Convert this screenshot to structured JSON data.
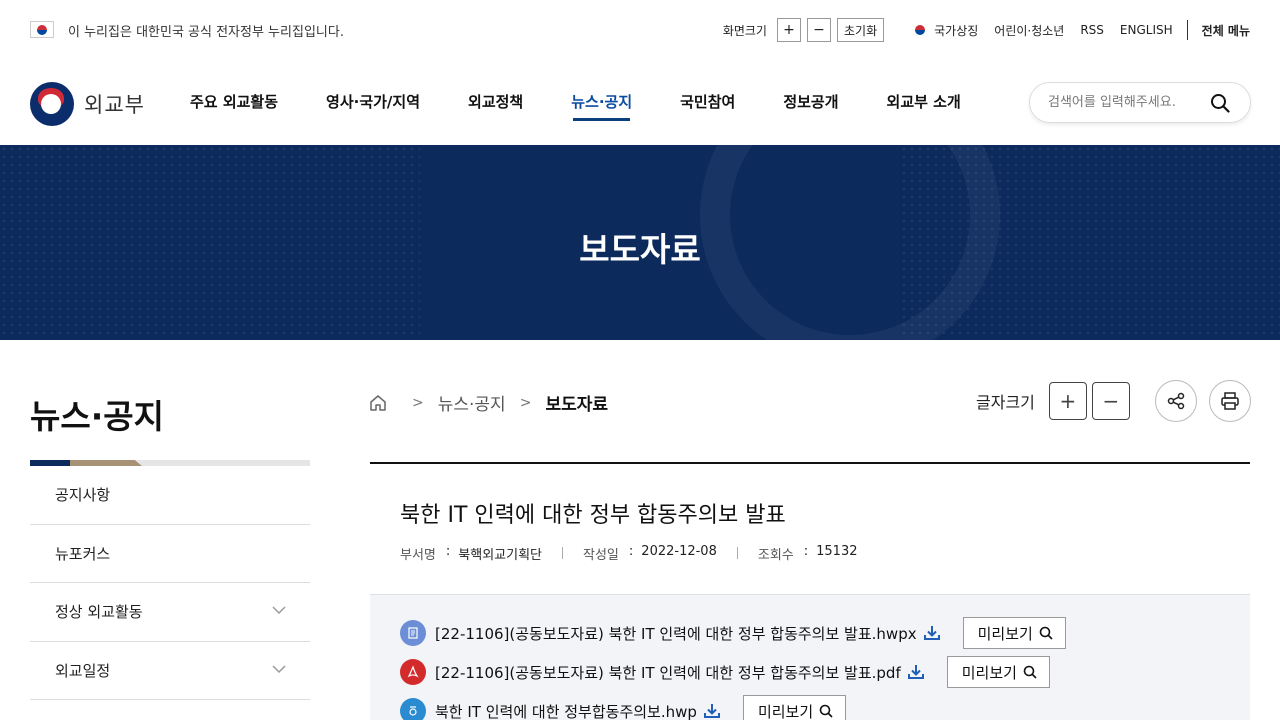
{
  "utility": {
    "gov_notice": "이 누리집은 대한민국 공식 전자정부 누리집입니다.",
    "zoom_label": "화면크기",
    "zoom_in": "+",
    "zoom_out": "−",
    "zoom_reset": "초기화",
    "links": [
      "국가상징",
      "어린이·청소년",
      "RSS",
      "ENGLISH"
    ],
    "all_menu": "전체 메뉴"
  },
  "header": {
    "logo_text": "외교부",
    "nav": [
      "주요 외교활동",
      "영사·국가/지역",
      "외교정책",
      "뉴스·공지",
      "국민참여",
      "정보공개",
      "외교부 소개"
    ],
    "active_nav_index": 3,
    "search_placeholder": "검색어를 입력해주세요."
  },
  "banner": {
    "title": "보도자료"
  },
  "lnb": {
    "title": "뉴스·공지",
    "items": [
      {
        "label": "공지사항",
        "expandable": false
      },
      {
        "label": "뉴포커스",
        "expandable": false
      },
      {
        "label": "정상 외교활동",
        "expandable": true
      },
      {
        "label": "외교일정",
        "expandable": true
      }
    ]
  },
  "breadcrumb": {
    "items": [
      "뉴스·공지",
      "보도자료"
    ]
  },
  "tools": {
    "font_label": "글자크기",
    "font_up": "+",
    "font_down": "−"
  },
  "article": {
    "title": "북한 IT 인력에 대한 정부 합동주의보 발표",
    "meta": {
      "dept_label": "부서명",
      "dept": "북핵외교기획단",
      "date_label": "작성일",
      "date": "2022-12-08",
      "views_label": "조회수",
      "views": "15132",
      "colon": ":"
    },
    "files": [
      {
        "name": "[22-1106](공동보도자료) 북한 IT 인력에 대한 정부 합동주의보 발표.hwpx",
        "type": "hwpx",
        "icon": "document-icon"
      },
      {
        "name": "[22-1106](공동보도자료) 북한 IT 인력에 대한 정부 합동주의보 발표.pdf",
        "type": "pdf",
        "icon": "pdf-icon"
      },
      {
        "name": "북한 IT 인력에 대한 정부합동주의보.hwp",
        "type": "hwp",
        "icon": "hwp-icon"
      }
    ],
    "preview_label": "미리보기"
  },
  "colors": {
    "navy": "#0c2a5c",
    "active_nav": "#0b4ba0",
    "gold": "#a89276",
    "pdf_red": "#d32b2b",
    "file_bg": "#f2f4f7"
  }
}
